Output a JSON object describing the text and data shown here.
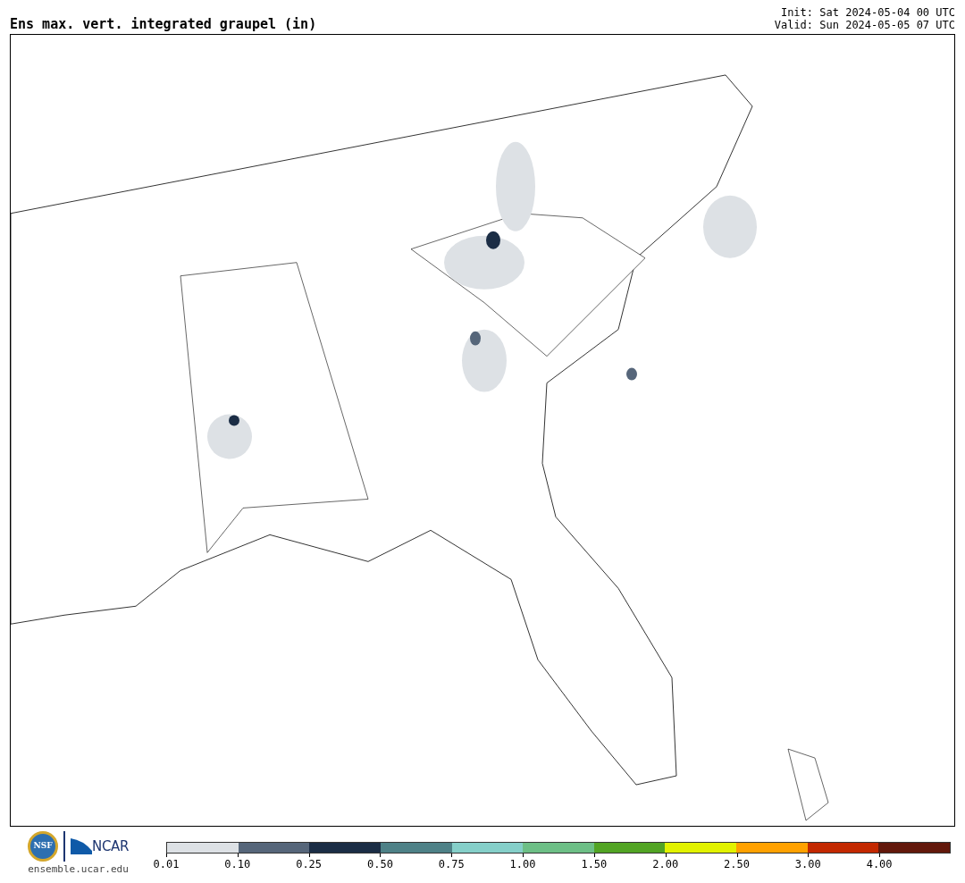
{
  "title": "Ens max. vert. integrated graupel (in)",
  "init": "Init: Sat 2024-05-04 00 UTC",
  "valid": "Valid: Sun 2024-05-05 07 UTC",
  "logos": {
    "nsf": "NSF",
    "ncar": "NCAR",
    "site": "ensemble.ucar.edu"
  },
  "colorbar": [
    {
      "label": "0.01",
      "color": "#dde1e5"
    },
    {
      "label": "0.10",
      "color": "#56667a"
    },
    {
      "label": "0.25",
      "color": "#1b2d45"
    },
    {
      "label": "0.50",
      "color": "#4e8187"
    },
    {
      "label": "0.75",
      "color": "#85cfc9"
    },
    {
      "label": "1.00",
      "color": "#6dbf86"
    },
    {
      "label": "1.50",
      "color": "#52a424"
    },
    {
      "label": "2.00",
      "color": "#e2f200"
    },
    {
      "label": "2.50",
      "color": "#ffa100"
    },
    {
      "label": "3.00",
      "color": "#c32800"
    },
    {
      "label": "4.00",
      "color": "#63180b"
    }
  ]
}
